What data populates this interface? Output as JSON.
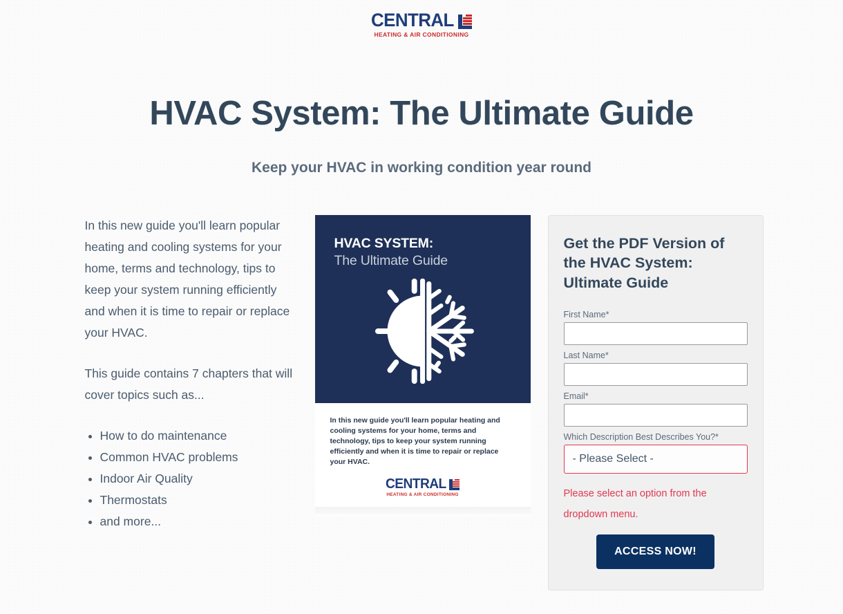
{
  "brand": {
    "name": "CENTRAL",
    "tagline": "HEATING  &  AIR CONDITIONING",
    "navy": "#1f3d7a",
    "red": "#cc2b2b"
  },
  "hero": {
    "title": "HVAC System: The Ultimate Guide",
    "subtitle": "Keep your HVAC in working condition year round"
  },
  "left_column": {
    "paragraph_1": "In this new guide you'll learn popular heating and cooling systems for your home, terms and technology, tips to keep your system running efficiently and when it is time to repair or replace your HVAC.",
    "paragraph_2": "This guide contains 7 chapters that will cover topics such as...",
    "bullets": [
      "How to do maintenance",
      "Common HVAC problems",
      "Indoor Air Quality",
      "Thermostats",
      "and more..."
    ]
  },
  "ebook_cover": {
    "title_line_1": "HVAC SYSTEM:",
    "title_line_2": "The Ultimate Guide",
    "blurb": "In this new guide you'll learn popular heating and cooling systems for your home, terms and technology, tips to keep your system running efficiently and when it is time to repair or replace your HVAC.",
    "background": "#1e3057",
    "icon": "sun-snowflake-icon"
  },
  "form": {
    "heading": "Get the PDF Version of the HVAC System: Ultimate Guide",
    "fields": [
      {
        "label": "First Name*",
        "value": "",
        "placeholder": ""
      },
      {
        "label": "Last Name*",
        "value": "",
        "placeholder": ""
      },
      {
        "label": "Email*",
        "value": "",
        "placeholder": ""
      }
    ],
    "select": {
      "label": "Which Description Best Describes You?*",
      "value": "- Please Select -"
    },
    "error_message": "Please select an option from the dropdown menu.",
    "error_color": "#e1384f",
    "submit_label": "ACCESS NOW!",
    "submit_color": "#0a3161"
  }
}
